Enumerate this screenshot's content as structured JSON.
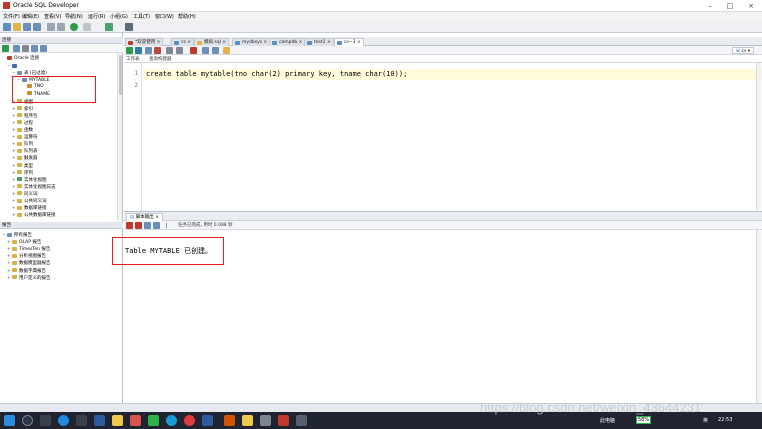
{
  "window": {
    "title": "Oracle SQL Developer"
  },
  "menu": [
    "文件(F)",
    "编辑(E)",
    "查看(V)",
    "导航(N)",
    "运行(R)",
    "小组(G)",
    "工具(T)",
    "窗口(W)",
    "帮助(H)"
  ],
  "connections_panel": {
    "title": "连接",
    "items": [
      {
        "label": "Oracle 连接",
        "level": 0,
        "exp": "",
        "color": "#c0392b"
      },
      {
        "label": "",
        "level": 1,
        "exp": "−",
        "color": "#3b6db3"
      },
      {
        "label": "表 (已过滤)",
        "level": 2,
        "exp": "−",
        "color": "#7a8fa8"
      },
      {
        "label": "MYTABLE",
        "level": 3,
        "exp": "−",
        "color": "#6a88b0"
      },
      {
        "label": "TNO",
        "level": 4,
        "exp": "",
        "color": "#d08b2e"
      },
      {
        "label": "TNAME",
        "level": 4,
        "exp": "",
        "color": "#d08b2e"
      },
      {
        "label": "视图",
        "level": 2,
        "exp": "+",
        "color": "#d7b24a"
      },
      {
        "label": "索引",
        "level": 2,
        "exp": "+",
        "color": "#d7b24a"
      },
      {
        "label": "程序包",
        "level": 2,
        "exp": "+",
        "color": "#d7b24a"
      },
      {
        "label": "过程",
        "level": 2,
        "exp": "+",
        "color": "#d7b24a"
      },
      {
        "label": "函数",
        "level": 2,
        "exp": "+",
        "color": "#d7b24a"
      },
      {
        "label": "运算符",
        "level": 2,
        "exp": "+",
        "color": "#d7b24a"
      },
      {
        "label": "队列",
        "level": 2,
        "exp": "+",
        "color": "#d7b24a"
      },
      {
        "label": "队列表",
        "level": 2,
        "exp": "+",
        "color": "#d7b24a"
      },
      {
        "label": "触发器",
        "level": 2,
        "exp": "+",
        "color": "#d7b24a"
      },
      {
        "label": "类型",
        "level": 2,
        "exp": "+",
        "color": "#d7b24a"
      },
      {
        "label": "序列",
        "level": 2,
        "exp": "+",
        "color": "#d7b24a"
      },
      {
        "label": "实体化视图",
        "level": 2,
        "exp": "+",
        "color": "#4a9a5a"
      },
      {
        "label": "实体化视图日志",
        "level": 2,
        "exp": "+",
        "color": "#d7b24a"
      },
      {
        "label": "同义词",
        "level": 2,
        "exp": "+",
        "color": "#d7b24a"
      },
      {
        "label": "公共同义词",
        "level": 2,
        "exp": "+",
        "color": "#d7b24a"
      },
      {
        "label": "数据库链接",
        "level": 2,
        "exp": "+",
        "color": "#d7b24a"
      },
      {
        "label": "公共数据库链接",
        "level": 2,
        "exp": "+",
        "color": "#d7b24a"
      }
    ]
  },
  "reports_panel": {
    "title": "报告",
    "items": [
      {
        "label": "所有报告",
        "level": 0,
        "exp": "−",
        "color": "#6d8fb8"
      },
      {
        "label": "OLAP 报告",
        "level": 1,
        "exp": "+",
        "color": "#d7b24a"
      },
      {
        "label": "TimesTen 报告",
        "level": 1,
        "exp": "+",
        "color": "#d7b24a"
      },
      {
        "label": "分析视图报告",
        "level": 1,
        "exp": "+",
        "color": "#d7b24a"
      },
      {
        "label": "数据模型器报告",
        "level": 1,
        "exp": "+",
        "color": "#d7b24a"
      },
      {
        "label": "数据字典报告",
        "level": 1,
        "exp": "+",
        "color": "#d7b24a"
      },
      {
        "label": "用户定义的报告",
        "level": 1,
        "exp": "+",
        "color": "#d7b24a"
      }
    ]
  },
  "doc_tabs": [
    {
      "label": "*欢迎使用"
    },
    {
      "label": "cs"
    },
    {
      "label": "模拟.sql"
    },
    {
      "label": "mydbsys"
    },
    {
      "label": "campdb"
    },
    {
      "label": "test1"
    },
    {
      "label": "cs~3"
    }
  ],
  "editor": {
    "subtab_worksheet": "工作表",
    "subtab_query_builder": "查询构建器",
    "connection_selector": "cs",
    "lines": [
      "create table mytable(tno char(2) primary key, tname char(10));",
      ""
    ]
  },
  "script_output": {
    "tab_label": "脚本输出",
    "status": "任务已完成, 用时 0.088 秒",
    "text": "Table MYTABLE 已创建。"
  },
  "taskbar": {
    "network": "此电脑",
    "battery": "58%",
    "ime": "英",
    "time": "22:53"
  },
  "watermark": "https://blog.csdn.net/weixin_43644231"
}
